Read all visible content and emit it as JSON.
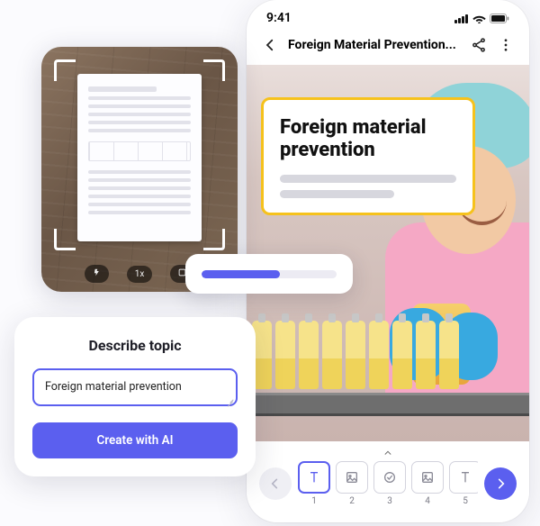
{
  "phone": {
    "status_time": "9:41",
    "header_title": "Foreign Material Prevention...",
    "hero_title": "Foreign material prevention",
    "slides": [
      {
        "num": "1",
        "icon": "text"
      },
      {
        "num": "2",
        "icon": "image"
      },
      {
        "num": "3",
        "icon": "check"
      },
      {
        "num": "4",
        "icon": "image"
      },
      {
        "num": "5",
        "icon": "text"
      }
    ]
  },
  "scan": {
    "zoom_label": "1x"
  },
  "progress": {
    "percent": 58
  },
  "topic": {
    "heading": "Describe topic",
    "input_value": "Foreign material prevention",
    "button_label": "Create with AI"
  }
}
